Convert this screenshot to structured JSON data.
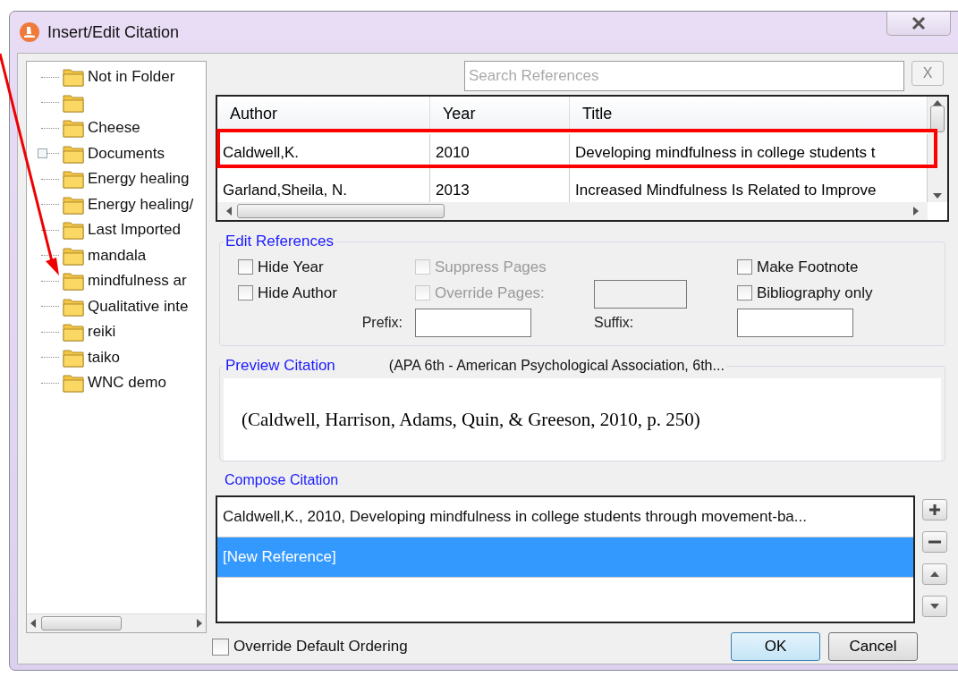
{
  "window": {
    "title": "Insert/Edit Citation"
  },
  "folders": [
    {
      "label": "Not in Folder",
      "expandable": false
    },
    {
      "expandable": false
    },
    {
      "label": "Cheese",
      "expandable": false
    },
    {
      "label": "Documents",
      "expandable": true
    },
    {
      "label": "Energy healing",
      "expandable": false
    },
    {
      "label": "Energy healing/",
      "expandable": false
    },
    {
      "label": "Last Imported",
      "expandable": false
    },
    {
      "label": "mandala",
      "expandable": false
    },
    {
      "label": "mindfulness ar",
      "expandable": false
    },
    {
      "label": "Qualitative inte",
      "expandable": false
    },
    {
      "label": "reiki",
      "expandable": false
    },
    {
      "label": "taiko",
      "expandable": false
    },
    {
      "label": "WNC demo",
      "expandable": false
    }
  ],
  "search": {
    "placeholder": "Search References",
    "clear_label": "X"
  },
  "table": {
    "columns": [
      "Author",
      "Year",
      "Title"
    ],
    "rows": [
      {
        "cells": [
          "Caldwell,K.",
          "2010",
          "Developing mindfulness in college students t"
        ],
        "annotated": true
      },
      {
        "cells": [
          "Garland,Sheila, N.",
          "2013",
          "Increased Mindfulness Is Related to Improve"
        ],
        "annotated": false
      }
    ]
  },
  "edit_references": {
    "title": "Edit References",
    "options": [
      {
        "label": "Hide Year",
        "checked": false,
        "disabled": false
      },
      {
        "label": "Hide Author",
        "checked": false,
        "disabled": false
      },
      {
        "label": "Suppress Pages",
        "checked": false,
        "disabled": true
      },
      {
        "label": "Override Pages:",
        "checked": false,
        "disabled": true
      },
      {
        "label": "Make Footnote",
        "checked": false,
        "disabled": false
      },
      {
        "label": "Bibliography only",
        "checked": false,
        "disabled": false
      }
    ],
    "prefix_label": "Prefix:",
    "suffix_label": "Suffix:"
  },
  "preview": {
    "title": "Preview Citation",
    "style": "(APA 6th - American Psychological Association, 6th...",
    "text": "(Caldwell, Harrison, Adams, Quin, & Greeson, 2010, p. 250)"
  },
  "compose": {
    "title": "Compose Citation",
    "items": [
      {
        "label": "Caldwell,K., 2010, Developing mindfulness in college students through movement-ba...",
        "selected": false
      },
      {
        "label": "[New Reference]",
        "selected": true
      }
    ]
  },
  "override_ordering": {
    "label": "Override Default Ordering",
    "checked": false
  },
  "buttons": [
    "OK",
    "Cancel"
  ]
}
